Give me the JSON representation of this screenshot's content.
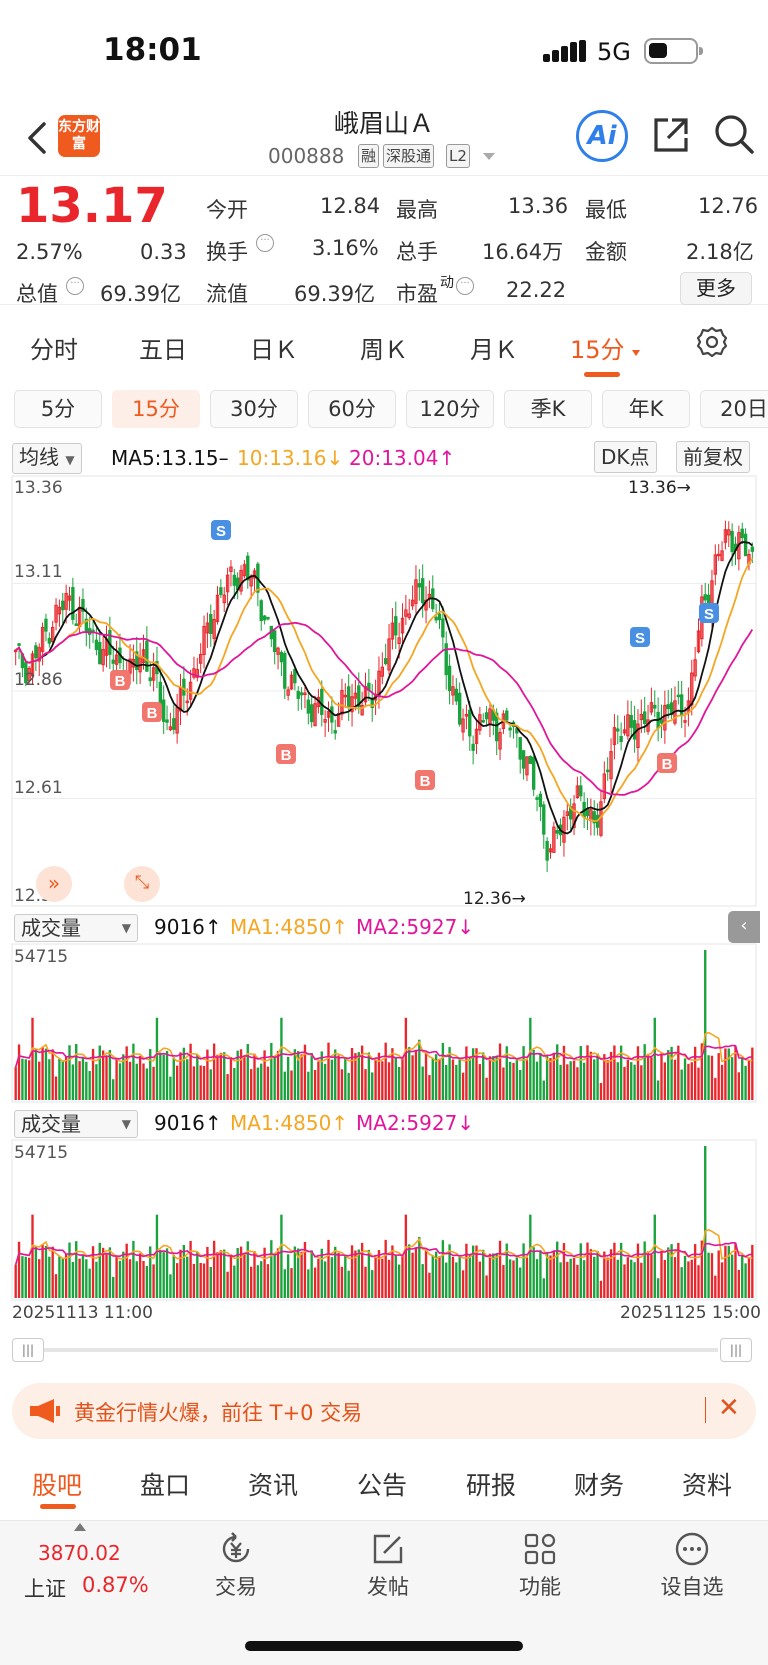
{
  "status_bar": {
    "time": "18:01",
    "network": "5G"
  },
  "header": {
    "logo_text": "东方财富",
    "title": "峨眉山Ａ",
    "code": "000888",
    "tags": [
      "融",
      "深股通",
      "L2"
    ],
    "ai_label": "Ai"
  },
  "quote": {
    "price": "13.17",
    "change_pct": "2.57%",
    "change": "0.33",
    "open_label": "今开",
    "open": "12.84",
    "high_label": "最高",
    "high": "13.36",
    "low_label": "最低",
    "low": "12.76",
    "turnover_label": "换手",
    "turnover": "3.16%",
    "volume_label": "总手",
    "volume": "16.64万",
    "amount_label": "金额",
    "amount": "2.18亿",
    "mcap_label": "总值",
    "mcap": "69.39亿",
    "float_label": "流值",
    "float": "69.39亿",
    "pe_label": "市盈",
    "pe_sup": "动",
    "pe": "22.22",
    "more": "更多"
  },
  "period_tabs": [
    "分时",
    "五日",
    "日Ｋ",
    "周Ｋ",
    "月Ｋ",
    "15分"
  ],
  "active_period": "15分",
  "sub_tabs": [
    "5分",
    "15分",
    "30分",
    "60分",
    "120分",
    "季K",
    "年K",
    "20日"
  ],
  "active_sub": "15分",
  "indicator_bar": {
    "type": "均线",
    "ma5": "MA5:13.15–",
    "ma10": "10:13.16↓",
    "ma20": "20:13.04↑",
    "dk": "DK点",
    "adjust": "前复权"
  },
  "colors": {
    "up": "#e8262b",
    "down": "#18a33c",
    "ma5": "#111111",
    "ma10": "#f5a623",
    "ma20": "#e0179a",
    "accent": "#ef5a1e",
    "ai": "#2f7fea"
  },
  "price_axis": {
    "ticks": [
      "13.36",
      "13.11",
      "12.86",
      "12.61",
      "12.36"
    ],
    "high_marker": "13.36→",
    "low_marker": "12.36→"
  },
  "volume_panels": [
    {
      "type": "成交量",
      "value": "9016↑",
      "ma1": "MA1:4850↑",
      "ma2": "MA2:5927↓",
      "max": "54715"
    },
    {
      "type": "成交量",
      "value": "9016↑",
      "ma1": "MA1:4850↑",
      "ma2": "MA2:5927↓",
      "max": "54715"
    }
  ],
  "time_axis": {
    "start": "20251113 11:00",
    "end": "20251125 15:00"
  },
  "notice": {
    "text": "黄金行情火爆，前往 T+0 交易"
  },
  "bottom_tabs": [
    "股吧",
    "盘口",
    "资讯",
    "公告",
    "研报",
    "财务",
    "资料"
  ],
  "active_bottom": "股吧",
  "dock": {
    "index_value": "3870.02",
    "index_name": "上证",
    "index_change": "0.87%",
    "items": [
      {
        "label": "交易",
        "icon": "yen-trade-icon"
      },
      {
        "label": "发帖",
        "icon": "edit-icon"
      },
      {
        "label": "功能",
        "icon": "grid-icon"
      },
      {
        "label": "设自选",
        "icon": "more-circle-icon"
      }
    ]
  },
  "chart_data": {
    "type": "candlestick",
    "ylim": [
      12.36,
      13.36
    ],
    "close": [
      12.94,
      12.91,
      12.97,
      13.03,
      13.07,
      13.04,
      12.98,
      12.95,
      12.93,
      12.9,
      12.95,
      12.88,
      12.77,
      12.83,
      12.9,
      12.99,
      13.08,
      13.12,
      13.14,
      13.1,
      12.99,
      12.91,
      12.86,
      12.83,
      12.81,
      12.79,
      12.84,
      12.85,
      12.83,
      12.94,
      13.0,
      13.06,
      13.1,
      13.05,
      12.91,
      12.79,
      12.76,
      12.8,
      12.78,
      12.78,
      12.71,
      12.62,
      12.48,
      12.55,
      12.61,
      12.58,
      12.56,
      12.77,
      12.76,
      12.79,
      12.8,
      12.81,
      12.82,
      12.83,
      13.05,
      13.14,
      13.23,
      13.2,
      13.17
    ],
    "buy_signals": [
      "B",
      "B",
      "B",
      "B",
      "B"
    ],
    "sell_signals": [
      "S",
      "S",
      "S"
    ]
  }
}
